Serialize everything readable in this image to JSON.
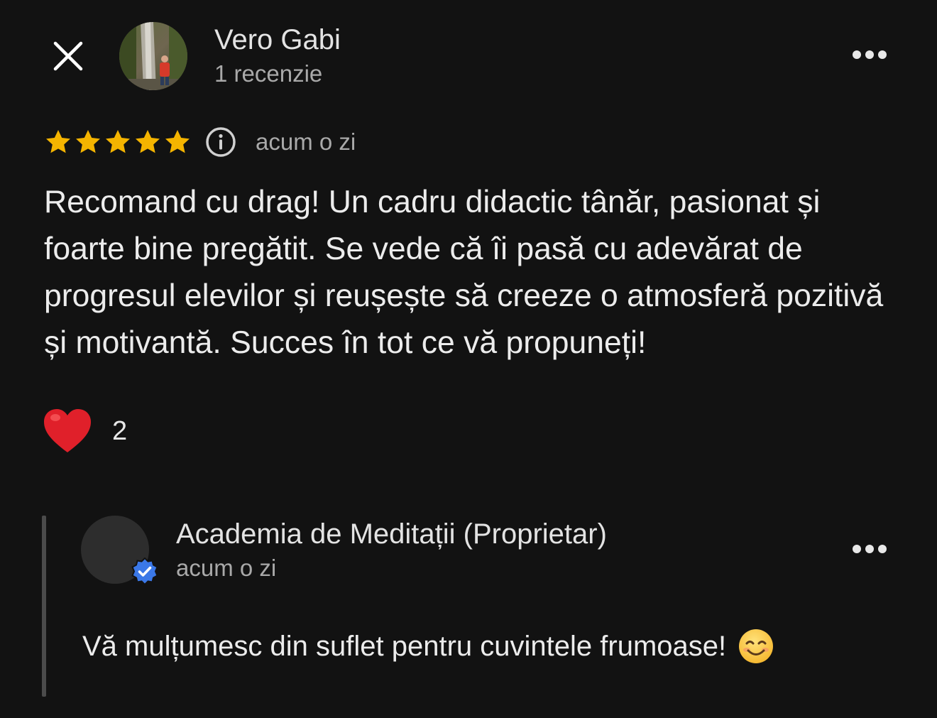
{
  "review": {
    "author": {
      "name": "Vero Gabi",
      "meta": "1 recenzie"
    },
    "rating": 5,
    "star_color": "#f4b400",
    "time": "acum o zi",
    "text": "Recomand cu drag!  Un cadru didactic tânăr, pasionat și foarte bine pregătit. Se vede că îi pasă cu adevărat de progresul elevilor și reușește să creeze o atmosferă pozitivă și motivantă. Succes în tot ce vă propuneți!",
    "reaction": {
      "icon": "heart-icon",
      "count": "2"
    }
  },
  "reply": {
    "owner_name": "Academia de Meditații (Proprietar)",
    "time": "acum o zi",
    "text": "Vă mulțumesc din suflet pentru cuvintele frumoase!",
    "verified_color": "#3b78e7"
  },
  "icons": {
    "close": "close-icon",
    "more": "more-horizontal-icon",
    "info": "info-icon",
    "emoji": "smiling-face-icon",
    "verified": "verified-badge-icon"
  }
}
